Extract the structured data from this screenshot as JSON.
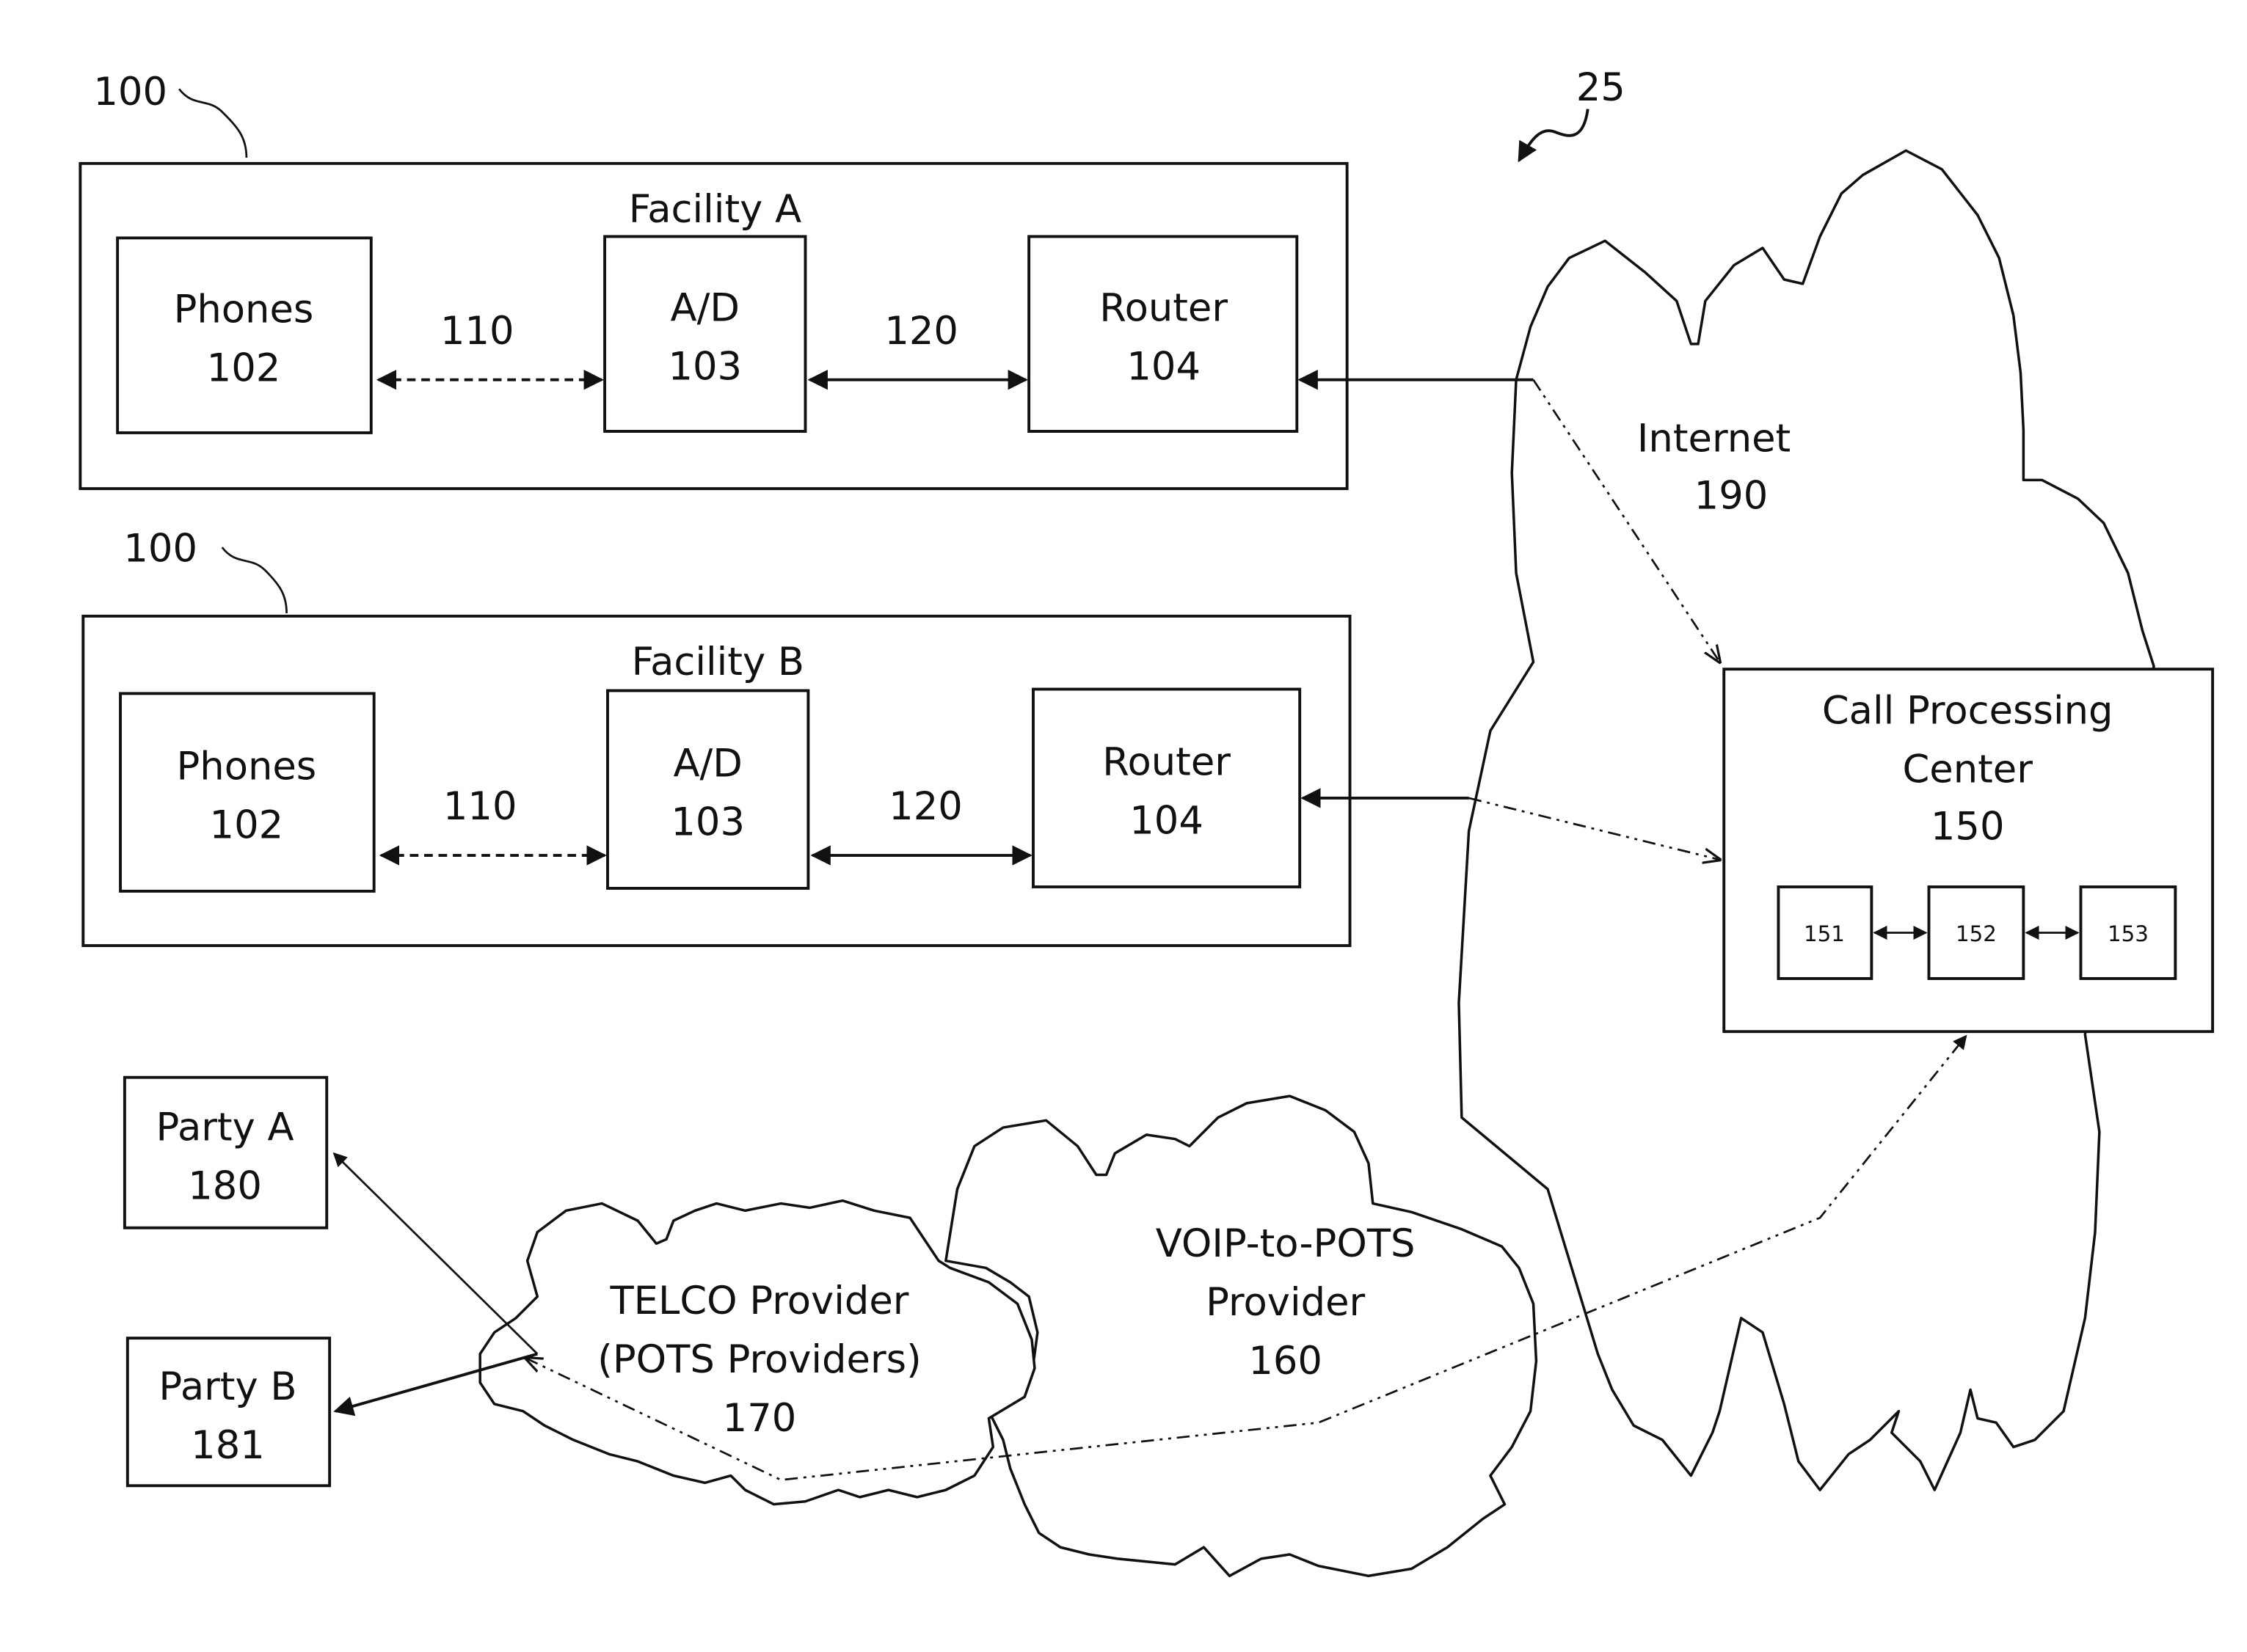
{
  "figure": {
    "reference_label": "25",
    "facilities": [
      {
        "ref": "100",
        "title": "Facility A",
        "phones": {
          "name": "Phones",
          "ref": "102"
        },
        "ad": {
          "name": "A/D",
          "ref": "103"
        },
        "router": {
          "name": "Router",
          "ref": "104"
        },
        "link_phone_ad": "110",
        "link_ad_router": "120"
      },
      {
        "ref": "100",
        "title": "Facility B",
        "phones": {
          "name": "Phones",
          "ref": "102"
        },
        "ad": {
          "name": "A/D",
          "ref": "103"
        },
        "router": {
          "name": "Router",
          "ref": "104"
        },
        "link_phone_ad": "110",
        "link_ad_router": "120"
      }
    ],
    "internet": {
      "name": "Internet",
      "ref": "190"
    },
    "call_processing_center": {
      "name_line1": "Call Processing",
      "name_line2": "Center",
      "ref": "150",
      "modules": [
        "151",
        "152",
        "153"
      ]
    },
    "voip_provider": {
      "name_line1": "VOIP-to-POTS",
      "name_line2": "Provider",
      "ref": "160"
    },
    "telco_provider": {
      "name_line1": "TELCO Provider",
      "name_line2": "(POTS Providers)",
      "ref": "170"
    },
    "parties": [
      {
        "name": "Party A",
        "ref": "180"
      },
      {
        "name": "Party B",
        "ref": "181"
      }
    ]
  }
}
